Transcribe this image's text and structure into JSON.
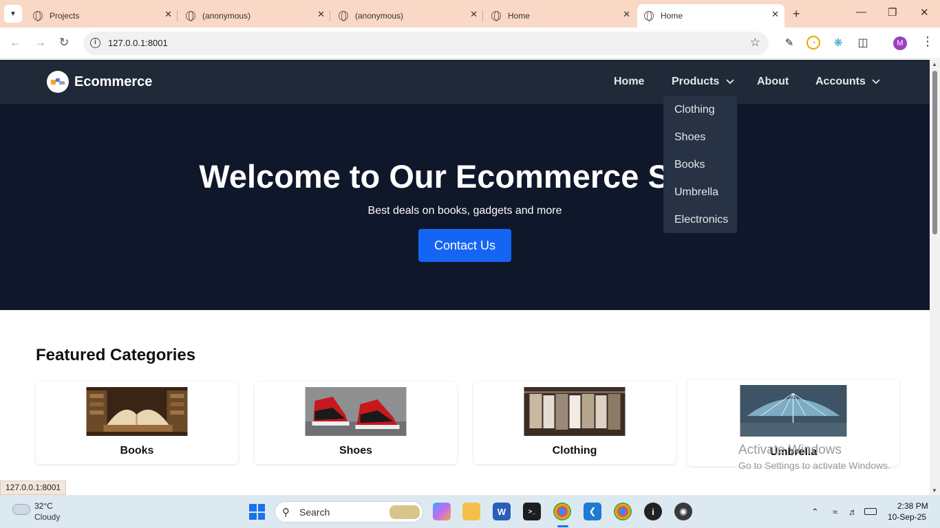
{
  "browser": {
    "tabs": [
      {
        "title": "Projects"
      },
      {
        "title": "(anonymous)"
      },
      {
        "title": "(anonymous)"
      },
      {
        "title": "Home"
      },
      {
        "title": "Home"
      }
    ],
    "url": "127.0.0.1:8001",
    "profile_initial": "M",
    "status_url": "127.0.0.1:8001"
  },
  "site": {
    "brand": "Ecommerce",
    "nav": {
      "home": "Home",
      "products": "Products",
      "about": "About",
      "accounts": "Accounts"
    },
    "products_menu": [
      "Clothing",
      "Shoes",
      "Books",
      "Umbrella",
      "Electronics"
    ],
    "hero": {
      "title": "Welcome to Our Ecommerce Store",
      "subtitle": "Best deals on books, gadgets and more",
      "cta": "Contact Us"
    },
    "featured_title": "Featured Categories",
    "categories": [
      "Books",
      "Shoes",
      "Clothing",
      "Umbrella"
    ]
  },
  "os": {
    "watermark_title": "Activate Windows",
    "watermark_sub": "Go to Settings to activate Windows.",
    "weather_temp": "32°C",
    "weather_cond": "Cloudy",
    "search_label": "Search",
    "time": "2:38 PM",
    "date": "10-Sep-25"
  },
  "colors": {
    "nav_bg": "#1f2937",
    "hero_bg": "#0f172a",
    "cta_bg": "#1565f5",
    "tabstrip_bg": "#f9d8c6"
  }
}
